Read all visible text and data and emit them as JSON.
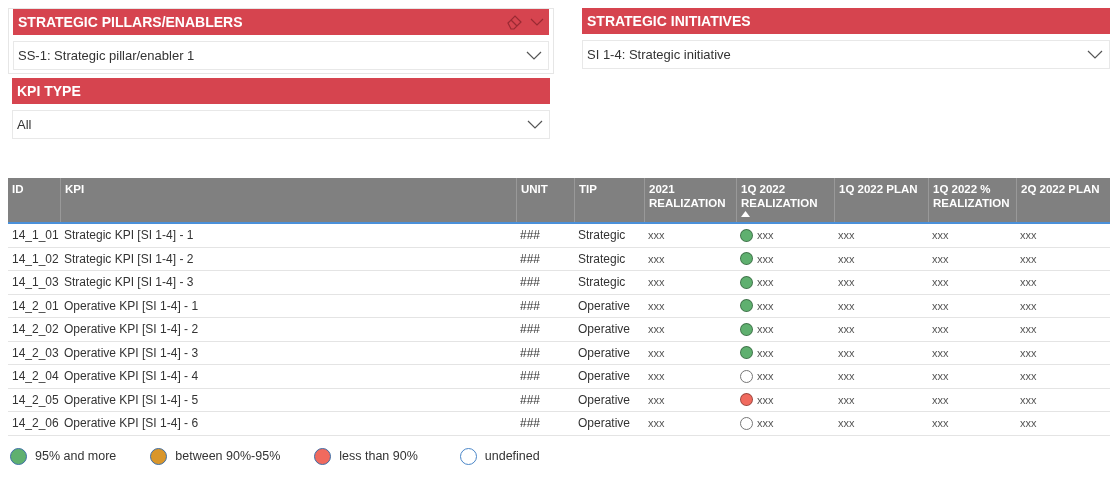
{
  "slicers": [
    {
      "title": "STRATEGIC PILLARS/ENABLERS",
      "value": "SS-1: Strategic pillar/enabler 1",
      "header_tools": true
    },
    {
      "title": "KPI TYPE",
      "value": "All",
      "header_tools": false
    },
    {
      "title": "STRATEGIC INITIATIVES",
      "value": "SI 1-4: Strategic initiative",
      "header_tools": false
    }
  ],
  "table": {
    "columns": [
      {
        "label": "ID",
        "sorted": false
      },
      {
        "label": "KPI",
        "sorted": false
      },
      {
        "label": "UNIT",
        "sorted": false
      },
      {
        "label": "TIP",
        "sorted": false
      },
      {
        "label": "2021 REALIZATION",
        "sorted": false
      },
      {
        "label": "1Q 2022 REALIZATION",
        "sorted": true
      },
      {
        "label": "1Q 2022 PLAN",
        "sorted": false
      },
      {
        "label": "1Q 2022 % REALIZATION",
        "sorted": false
      },
      {
        "label": "2Q 2022 PLAN",
        "sorted": false
      }
    ],
    "rows": [
      {
        "cells": [
          "14_1_01",
          "Strategic KPI [SI 1-4] - 1",
          "###",
          "Strategic",
          "xxx",
          "xxx",
          "xxx",
          "xxx",
          "xxx"
        ],
        "color": "#5fb06f"
      },
      {
        "cells": [
          "14_1_02",
          "Strategic KPI [SI 1-4] - 2",
          "###",
          "Strategic",
          "xxx",
          "xxx",
          "xxx",
          "xxx",
          "xxx"
        ],
        "color": "#5fb06f"
      },
      {
        "cells": [
          "14_1_03",
          "Strategic KPI [SI 1-4] - 3",
          "###",
          "Strategic",
          "xxx",
          "xxx",
          "xxx",
          "xxx",
          "xxx"
        ],
        "color": "#5fb06f"
      },
      {
        "cells": [
          "14_2_01",
          "Operative KPI [SI 1-4] - 1",
          "###",
          "Operative",
          "xxx",
          "xxx",
          "xxx",
          "xxx",
          "xxx"
        ],
        "color": "#5fb06f"
      },
      {
        "cells": [
          "14_2_02",
          "Operative KPI [SI 1-4] - 2",
          "###",
          "Operative",
          "xxx",
          "xxx",
          "xxx",
          "xxx",
          "xxx"
        ],
        "color": "#5fb06f"
      },
      {
        "cells": [
          "14_2_03",
          "Operative KPI [SI 1-4] - 3",
          "###",
          "Operative",
          "xxx",
          "xxx",
          "xxx",
          "xxx",
          "xxx"
        ],
        "color": "#5fb06f"
      },
      {
        "cells": [
          "14_2_04",
          "Operative KPI [SI 1-4] - 4",
          "###",
          "Operative",
          "xxx",
          "xxx",
          "xxx",
          "xxx",
          "xxx"
        ],
        "color": "#ffffff"
      },
      {
        "cells": [
          "14_2_05",
          "Operative KPI [SI 1-4] - 5",
          "###",
          "Operative",
          "xxx",
          "xxx",
          "xxx",
          "xxx",
          "xxx"
        ],
        "color": "#f06a5e"
      },
      {
        "cells": [
          "14_2_06",
          "Operative KPI [SI 1-4] - 6",
          "###",
          "Operative",
          "xxx",
          "xxx",
          "xxx",
          "xxx",
          "xxx"
        ],
        "color": "#ffffff"
      }
    ]
  },
  "legend": [
    {
      "label": "95% and more",
      "color": "#5fb06f"
    },
    {
      "label": "between 90%-95%",
      "color": "#d9962b"
    },
    {
      "label": "less than 90%",
      "color": "#f06a5e"
    },
    {
      "label": "undefined",
      "color": "#ffffff"
    }
  ]
}
